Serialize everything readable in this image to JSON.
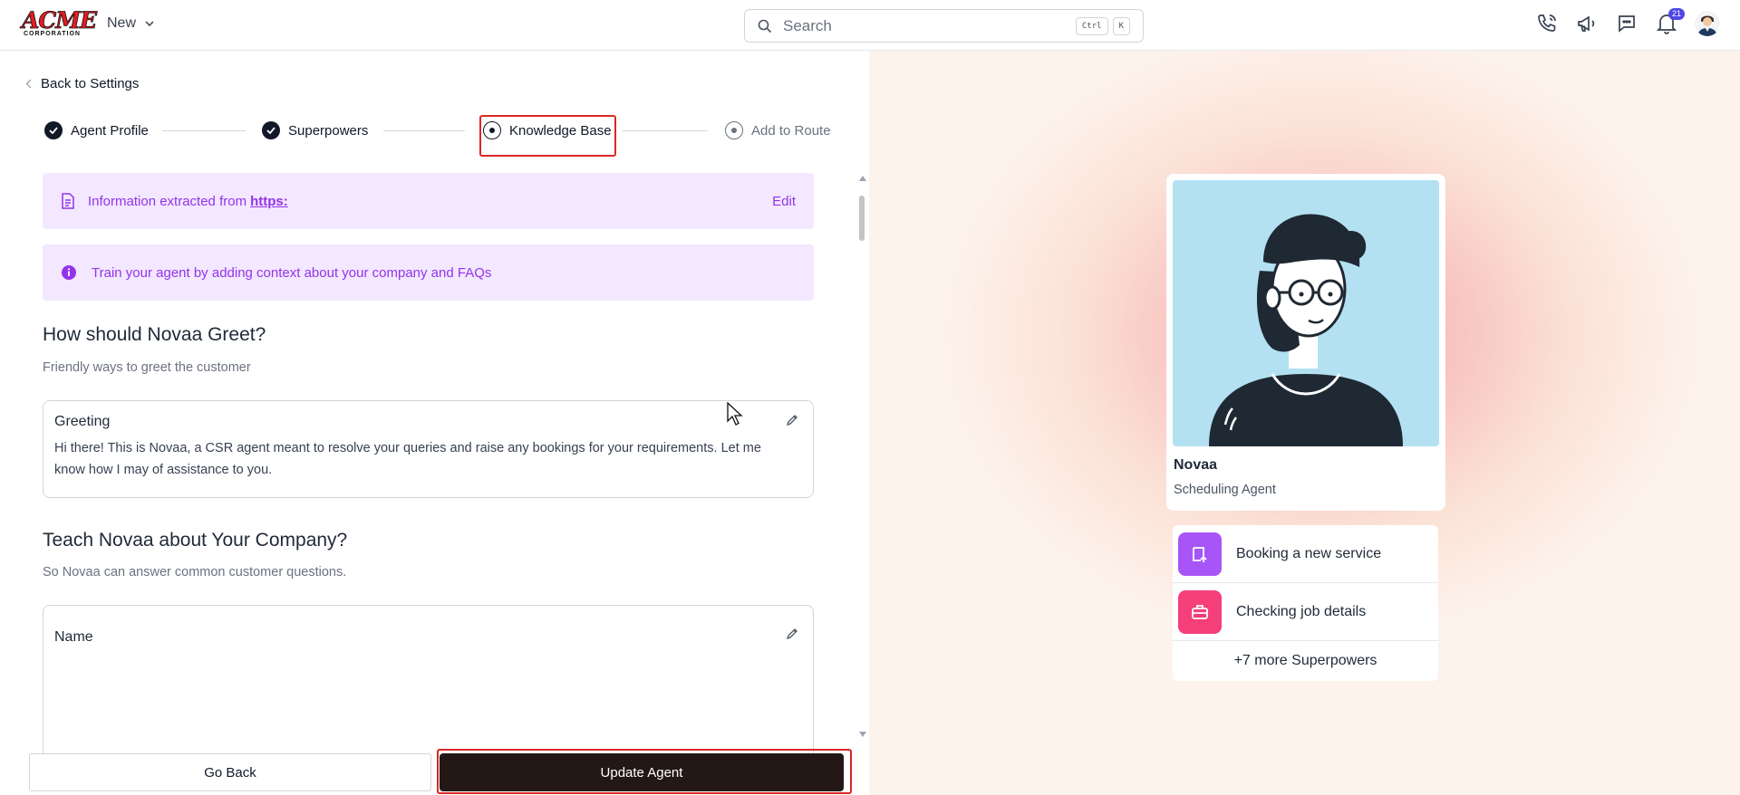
{
  "topbar": {
    "logo_text": "ACME",
    "logo_subtext": "CORPORATION",
    "new_label": "New",
    "search_placeholder": "Search",
    "shortcut_ctrl": "Ctrl",
    "shortcut_key": "K",
    "notification_count": "21",
    "icons": [
      "phone-icon",
      "megaphone-icon",
      "chat-icon",
      "bell-icon",
      "user-avatar"
    ]
  },
  "nav": {
    "back_label": "Back to Settings"
  },
  "stepper": {
    "steps": [
      {
        "label": "Agent Profile",
        "state": "done"
      },
      {
        "label": "Superpowers",
        "state": "done"
      },
      {
        "label": "Knowledge Base",
        "state": "current"
      },
      {
        "label": "Add to Route",
        "state": "pending"
      }
    ]
  },
  "banners": {
    "extracted_prefix": "Information extracted from",
    "extracted_link": "https:",
    "edit_label": "Edit",
    "train_text": "Train your agent by adding context about your company and FAQs"
  },
  "greet_section": {
    "title": "How should Novaa Greet?",
    "subtitle": "Friendly ways to greet the customer",
    "card_title": "Greeting",
    "card_body": "Hi there! This is Novaa, a CSR agent meant to resolve your queries and raise any bookings for your requirements. Let me know how I may of assistance to you."
  },
  "company_section": {
    "title": "Teach Novaa about Your Company?",
    "subtitle": "So Novaa can answer common customer questions.",
    "card_title": "Name"
  },
  "footer": {
    "go_back_label": "Go Back",
    "update_label": "Update Agent"
  },
  "preview": {
    "agent_name": "Novaa",
    "agent_role": "Scheduling Agent",
    "superpowers": [
      {
        "label": "Booking a new service",
        "icon": "calendar-arrow-icon",
        "color": "#a855f7"
      },
      {
        "label": "Checking job details",
        "icon": "briefcase-icon",
        "color": "#f43f7a"
      }
    ],
    "more_label": "+7 more Superpowers"
  },
  "colors": {
    "accent_purple": "#9333ea",
    "banner_bg": "#f3e8ff",
    "primary_button": "#231815",
    "highlight_red": "#dc2626"
  }
}
